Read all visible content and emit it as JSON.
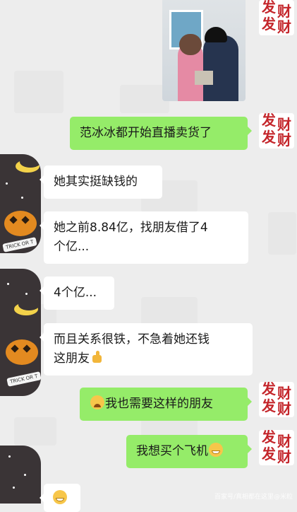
{
  "messages": [
    {
      "side": "right",
      "type": "image",
      "alt": "photo"
    },
    {
      "side": "right",
      "text": "范冰冰都开始直播卖货了"
    },
    {
      "side": "left",
      "text": "她其实挺缺钱的"
    },
    {
      "side": "left",
      "text_line1": "她之前8.84亿，找朋友借了4",
      "text_line2": "个亿..."
    },
    {
      "side": "left",
      "text": "4个亿..."
    },
    {
      "side": "left",
      "text_line1": "而且关系很铁，不急着她还钱",
      "text_line2": "这朋友"
    },
    {
      "side": "right",
      "text": "我也需要这样的朋友",
      "emoji": "crying-laughing"
    },
    {
      "side": "right",
      "text": "我想买个飞机",
      "emoji": "grin"
    },
    {
      "side": "left",
      "type": "emoji-only",
      "emoji": "grin"
    }
  ],
  "avatar_right": {
    "chars": [
      "发",
      "财",
      "发",
      "财"
    ],
    "color": "#c4262b"
  },
  "avatar_left": {
    "label": "TRICK OR T"
  },
  "watermark": "百家号/真相都在这里@米粒",
  "colors": {
    "background": "#ededed",
    "bubble_right": "#95ec69",
    "bubble_left": "#ffffff"
  }
}
